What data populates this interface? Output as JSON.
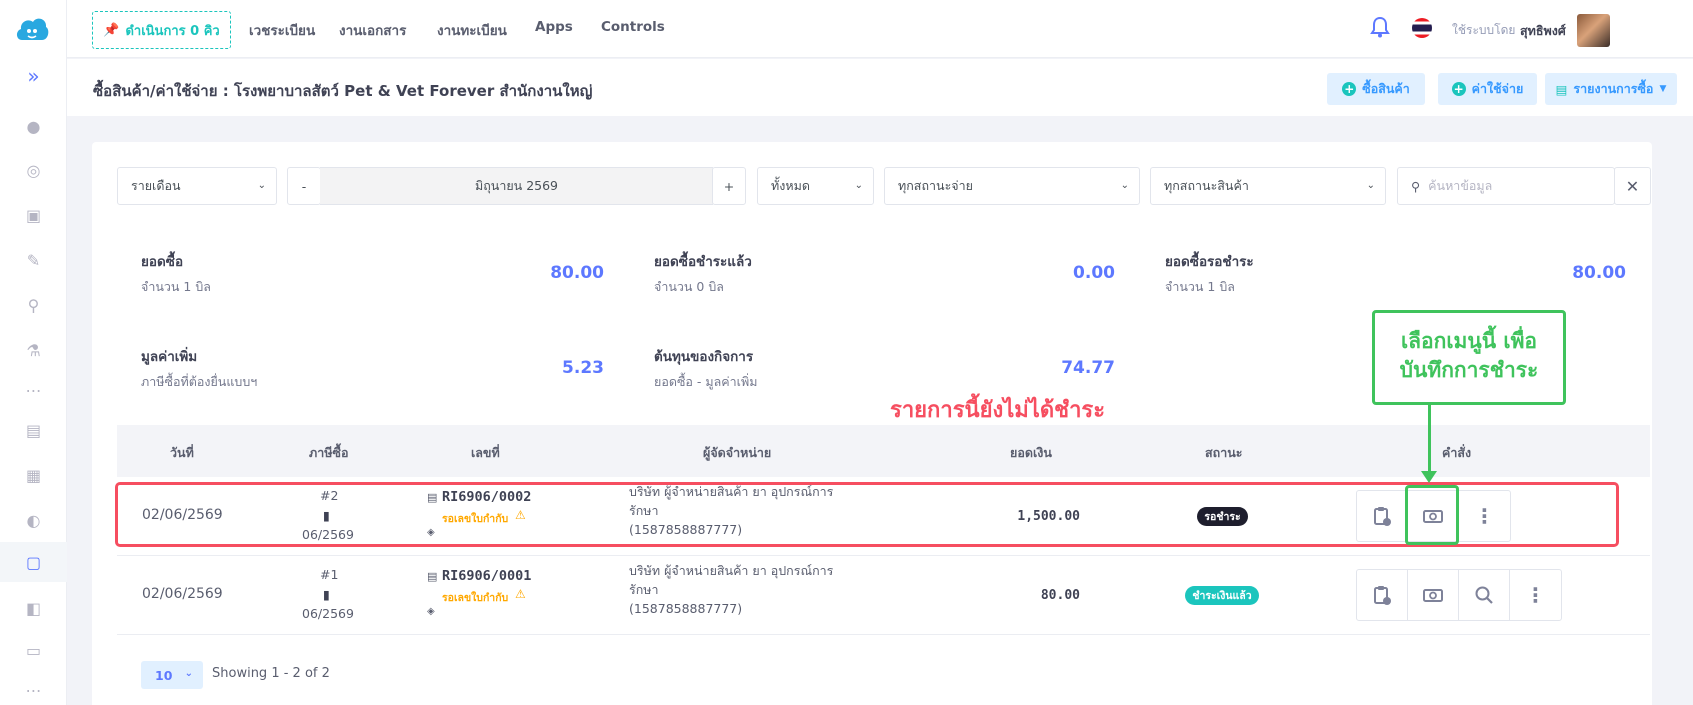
{
  "topbar": {
    "queue_label": "ดำเนินการ 0 คิว",
    "nav": [
      "เวชระเบียน",
      "งานเอกสาร",
      "งานทะเบียน",
      "Apps",
      "Controls"
    ],
    "user_label": "ใช้ระบบโดย",
    "user_name": "สุทธิพงศ์"
  },
  "subheader": {
    "title": "ซื้อสินค้า/ค่าใช้จ่าย : โรงพยาบาลสัตว์ Pet & Vet Forever สำนักงานใหญ่",
    "buy_label": "ซื้อสินค้า",
    "expense_label": "ค่าใช้จ่าย",
    "report_label": "รายงานการซื้อ"
  },
  "filters": {
    "period": "รายเดือน",
    "minus": "-",
    "month": "มิถุนายน 2569",
    "plus": "+",
    "scope": "ทั้งหมด",
    "pay_status": "ทุกสถานะจ่าย",
    "item_status": "ทุกสถานะสินค้า",
    "search_placeholder": "ค้นหาข้อมูล"
  },
  "stats": {
    "purchase": {
      "label": "ยอดซื้อ",
      "sub": "จำนวน 1 บิล",
      "value": "80.00"
    },
    "paid": {
      "label": "ยอดซื้อชำระแล้ว",
      "sub": "จำนวน 0 บิล",
      "value": "0.00"
    },
    "pending": {
      "label": "ยอดซื้อรอชำระ",
      "sub": "จำนวน 1 บิล",
      "value": "80.00"
    },
    "vat": {
      "label": "มูลค่าเพิ่ม",
      "sub": "ภาษีซื้อที่ต้องยื่นแบบฯ",
      "value": "5.23"
    },
    "cost": {
      "label": "ต้นทุนของกิจการ",
      "sub": "ยอดซื้อ - มูลค่าเพิ่ม",
      "value": "74.77"
    }
  },
  "annotations": {
    "unpaid_note": "รายการนี้ยังไม่ได้ชำระ",
    "menu_line1": "เลือกเมนูนี้ เพื่อ",
    "menu_line2": "บันทึกการชำระ"
  },
  "table": {
    "headers": [
      "วันที่",
      "ภาษีซื้อ",
      "เลขที่",
      "ผู้จัดจำหน่าย",
      "ยอดเงิน",
      "สถานะ",
      "คำสั่ง"
    ],
    "rows": [
      {
        "date": "02/06/2569",
        "tax_no": "#2",
        "tax_period": "06/2569",
        "doc_no": "RI6906/0002",
        "wait": "รอเลขใบกำกับ",
        "supplier1": "บริษัท ผู้จำหน่ายสินค้า ยา อุปกรณ์การ",
        "supplier2": "รักษา",
        "supplier3": "(1587858887777)",
        "amount": "1,500.00",
        "status": "รอชำระ"
      },
      {
        "date": "02/06/2569",
        "tax_no": "#1",
        "tax_period": "06/2569",
        "doc_no": "RI6906/0001",
        "wait": "รอเลขใบกำกับ",
        "supplier1": "บริษัท ผู้จำหน่ายสินค้า ยา อุปกรณ์การ",
        "supplier2": "รักษา",
        "supplier3": "(1587858887777)",
        "amount": "80.00",
        "status": "ชำระเงินแล้ว"
      }
    ]
  },
  "pagination": {
    "page_size": "10",
    "showing": "Showing 1 - 2 of 2"
  },
  "colors": {
    "accent": "#5d78ff",
    "success": "#1bc5bd",
    "warning": "#ffa800",
    "danger": "#f64e60",
    "annotation_green": "#3fc35c"
  }
}
